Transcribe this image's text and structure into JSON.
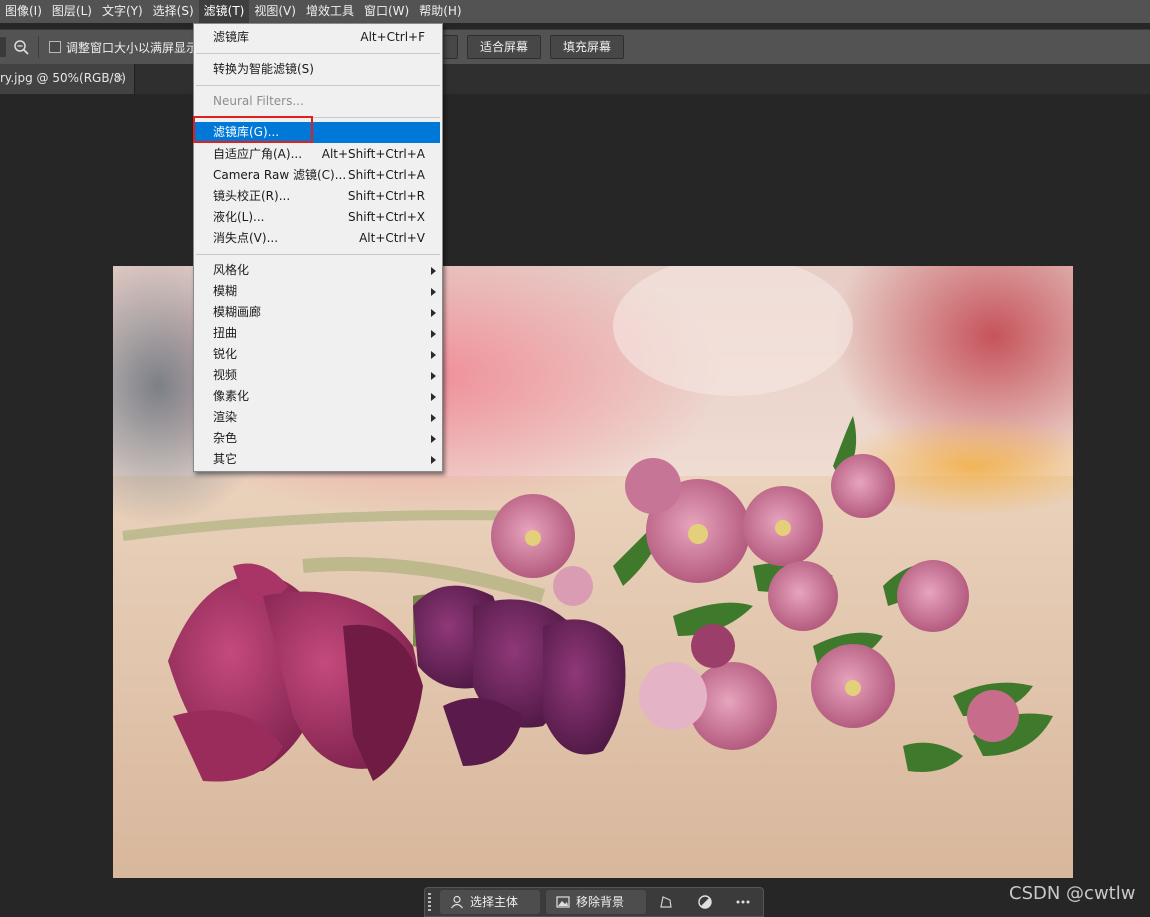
{
  "menubar": {
    "items": [
      "图像(I)",
      "图层(L)",
      "文字(Y)",
      "选择(S)",
      "滤镜(T)",
      "视图(V)",
      "增效工具",
      "窗口(W)",
      "帮助(H)"
    ]
  },
  "options_bar": {
    "checkbox_label": "调整窗口大小以满屏显示",
    "fit_screen": "适合屏幕",
    "fill_screen": "填充屏幕"
  },
  "document_tab": {
    "title": "ry.jpg @ 50%(RGB/8)",
    "close": "×"
  },
  "filter_menu": {
    "last_filter": {
      "label": "滤镜库",
      "shortcut": "Alt+Ctrl+F"
    },
    "convert_smart": "转换为智能滤镜(S)",
    "neural_filters": "Neural Filters...",
    "items": [
      {
        "label": "滤镜库(G)...",
        "shortcut": ""
      },
      {
        "label": "自适应广角(A)...",
        "shortcut": "Alt+Shift+Ctrl+A"
      },
      {
        "label": "Camera Raw 滤镜(C)...",
        "shortcut": "Shift+Ctrl+A"
      },
      {
        "label": "镜头校正(R)...",
        "shortcut": "Shift+Ctrl+R"
      },
      {
        "label": "液化(L)...",
        "shortcut": "Shift+Ctrl+X"
      },
      {
        "label": "消失点(V)...",
        "shortcut": "Alt+Ctrl+V"
      }
    ],
    "submenus": [
      "风格化",
      "模糊",
      "模糊画廊",
      "扭曲",
      "锐化",
      "视频",
      "像素化",
      "渲染",
      "杂色",
      "其它"
    ]
  },
  "taskbar": {
    "select_subject": "选择主体",
    "remove_background": "移除背景"
  },
  "watermark": "CSDN @cwtlw",
  "colors": {
    "highlight": "#0078d7",
    "callout": "#e0201c"
  }
}
